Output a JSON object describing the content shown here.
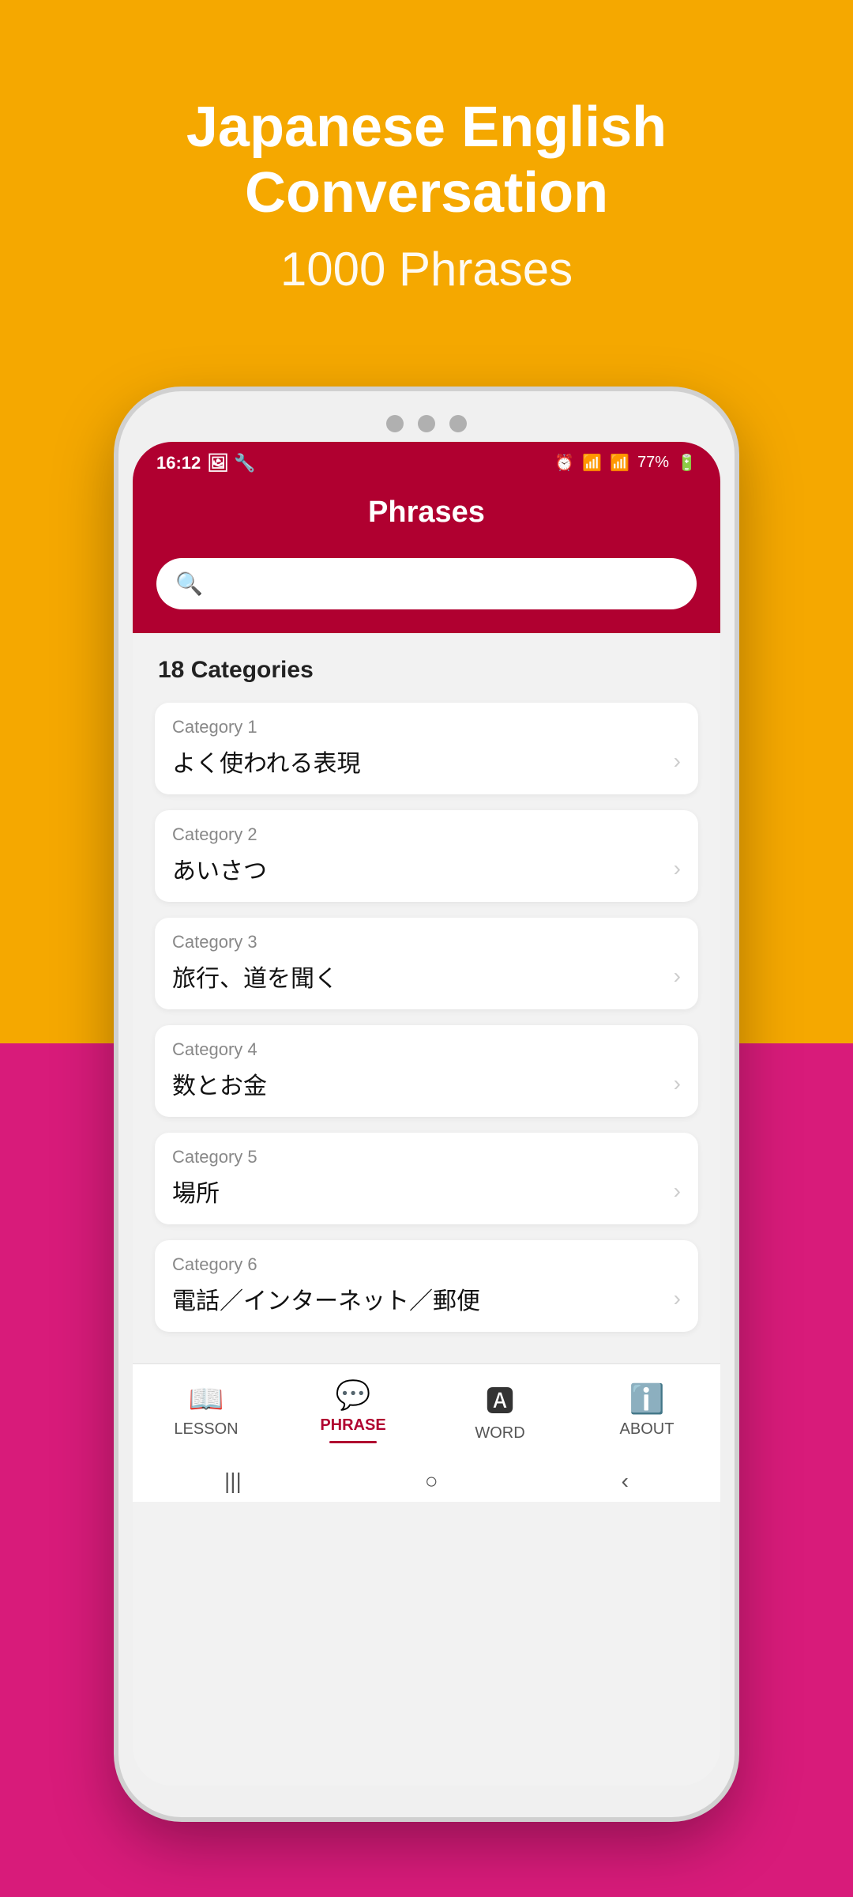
{
  "app": {
    "title": "Japanese English Conversation",
    "subtitle": "1000 Phrases"
  },
  "status_bar": {
    "time": "16:12",
    "battery": "77%"
  },
  "header": {
    "title": "Phrases"
  },
  "search": {
    "placeholder": ""
  },
  "categories_count": "18 Categories",
  "categories": [
    {
      "label": "Category 1",
      "name": "よく使われる表現"
    },
    {
      "label": "Category 2",
      "name": "あいさつ"
    },
    {
      "label": "Category 3",
      "name": "旅行、道を聞く"
    },
    {
      "label": "Category 4",
      "name": "数とお金"
    },
    {
      "label": "Category 5",
      "name": "場所"
    },
    {
      "label": "Category 6",
      "name": "電話／インターネット／郵便"
    }
  ],
  "bottom_nav": [
    {
      "label": "LESSON",
      "active": false
    },
    {
      "label": "PHRASE",
      "active": true
    },
    {
      "label": "WORD",
      "active": false
    },
    {
      "label": "ABOUT",
      "active": false
    }
  ]
}
